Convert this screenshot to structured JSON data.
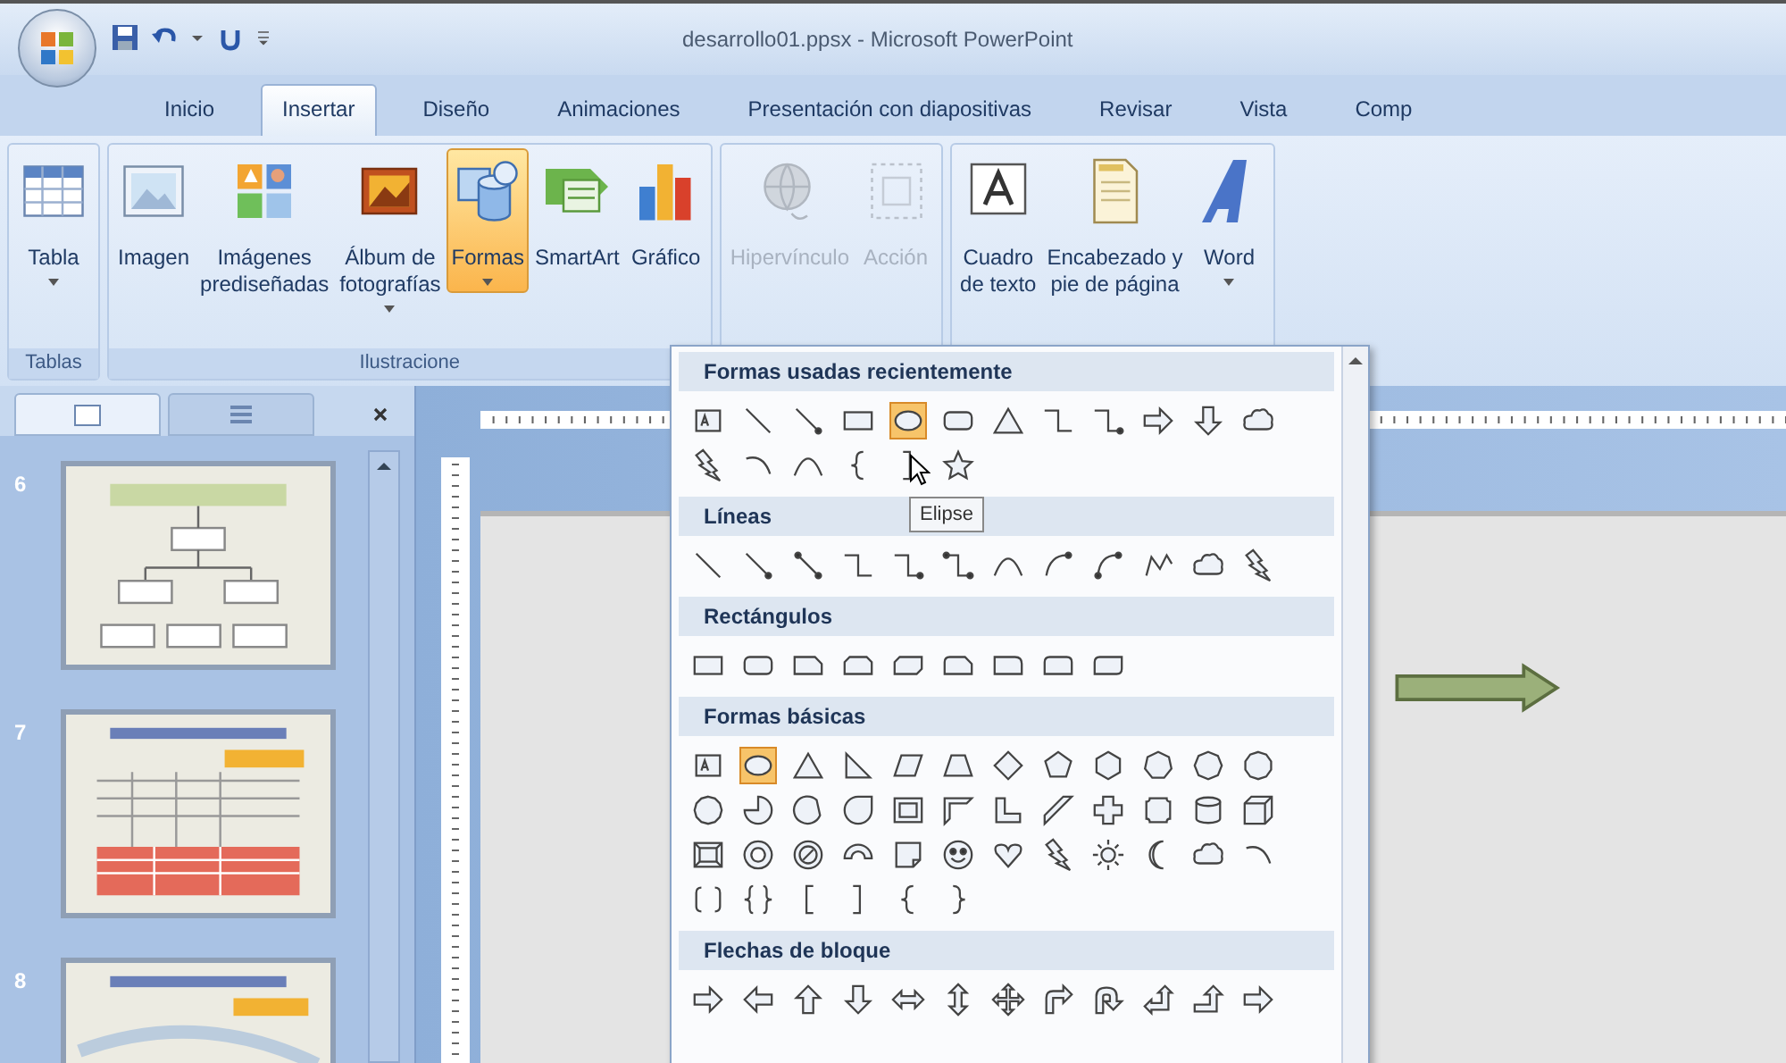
{
  "title_bar": {
    "title": "desarrollo01.ppsx - Microsoft PowerPoint"
  },
  "tabs": [
    {
      "label": "Inicio",
      "selected": false
    },
    {
      "label": "Insertar",
      "selected": true
    },
    {
      "label": "Diseño",
      "selected": false
    },
    {
      "label": "Animaciones",
      "selected": false
    },
    {
      "label": "Presentación con diapositivas",
      "selected": false
    },
    {
      "label": "Revisar",
      "selected": false
    },
    {
      "label": "Vista",
      "selected": false
    },
    {
      "label": "Comp",
      "selected": false
    }
  ],
  "ribbon": {
    "groups": [
      {
        "label": "Tablas",
        "buttons": [
          {
            "label": "Tabla",
            "kind": "table",
            "menu": true,
            "selected": false,
            "disabled": false
          }
        ]
      },
      {
        "label": "Ilustracione",
        "buttons": [
          {
            "label": "Imagen",
            "kind": "picture",
            "menu": false,
            "selected": false,
            "disabled": false
          },
          {
            "label": "Imágenes\nprediseñadas",
            "kind": "clipart",
            "menu": false,
            "selected": false,
            "disabled": false
          },
          {
            "label": "Álbum de\nfotografías",
            "kind": "album",
            "menu": true,
            "selected": false,
            "disabled": false
          },
          {
            "label": "Formas",
            "kind": "shapes",
            "menu": true,
            "selected": true,
            "disabled": false
          },
          {
            "label": "SmartArt",
            "kind": "smartart",
            "menu": false,
            "selected": false,
            "disabled": false
          },
          {
            "label": "Gráfico",
            "kind": "chart",
            "menu": false,
            "selected": false,
            "disabled": false
          }
        ]
      },
      {
        "buttons": [
          {
            "label": "Hipervínculo",
            "kind": "hyperlink",
            "menu": false,
            "selected": false,
            "disabled": true
          },
          {
            "label": "Acción",
            "kind": "action",
            "menu": false,
            "selected": false,
            "disabled": true
          }
        ]
      },
      {
        "buttons": [
          {
            "label": "Cuadro\nde texto",
            "kind": "textbox",
            "menu": false,
            "selected": false,
            "disabled": false
          },
          {
            "label": "Encabezado y\npie de página",
            "kind": "header",
            "menu": false,
            "selected": false,
            "disabled": false
          },
          {
            "label": "Word",
            "kind": "wordart",
            "menu": true,
            "selected": false,
            "disabled": false
          }
        ]
      }
    ]
  },
  "slides_pane": {
    "tabs": [
      {
        "kind": "slides",
        "selected": true
      },
      {
        "kind": "outline",
        "selected": false
      }
    ],
    "slides": [
      {
        "number": "6",
        "kind": "orgchart"
      },
      {
        "number": "7",
        "kind": "table"
      },
      {
        "number": "8",
        "kind": "diagram"
      }
    ]
  },
  "shapes_gallery": {
    "tooltip": "Elipse",
    "sections": [
      {
        "title": "Formas usadas recientemente",
        "rows": [
          [
            {
              "kind": "text-box",
              "selected": false
            },
            {
              "kind": "line",
              "selected": false
            },
            {
              "kind": "arrow-line",
              "selected": false
            },
            {
              "kind": "rectangle",
              "selected": false
            },
            {
              "kind": "ellipse",
              "selected": true
            },
            {
              "kind": "rounded-rectangle",
              "selected": false
            },
            {
              "kind": "triangle",
              "selected": false
            },
            {
              "kind": "elbow-connector",
              "selected": false
            },
            {
              "kind": "elbow-arrow",
              "selected": false
            },
            {
              "kind": "right-arrow",
              "selected": false
            },
            {
              "kind": "down-arrow",
              "selected": false
            },
            {
              "kind": "cloud",
              "selected": false
            }
          ],
          [
            {
              "kind": "lightning",
              "selected": false
            },
            {
              "kind": "arc",
              "selected": false
            },
            {
              "kind": "curve",
              "selected": false
            },
            {
              "kind": "left-brace",
              "selected": false
            },
            {
              "kind": "right-bracket",
              "selected": false
            },
            {
              "kind": "star",
              "selected": false
            }
          ]
        ]
      },
      {
        "title": "Líneas",
        "rows": [
          [
            {
              "kind": "line",
              "selected": false
            },
            {
              "kind": "arrow-line",
              "selected": false
            },
            {
              "kind": "double-arrow-line",
              "selected": false
            },
            {
              "kind": "elbow-connector",
              "selected": false
            },
            {
              "kind": "elbow-arrow",
              "selected": false
            },
            {
              "kind": "elbow-double-arrow",
              "selected": false
            },
            {
              "kind": "curve",
              "selected": false
            },
            {
              "kind": "curved-arrow",
              "selected": false
            },
            {
              "kind": "curved-double-arrow",
              "selected": false
            },
            {
              "kind": "freeform",
              "selected": false
            },
            {
              "kind": "cloud",
              "selected": false
            },
            {
              "kind": "lightning",
              "selected": false
            }
          ]
        ]
      },
      {
        "title": "Rectángulos",
        "rows": [
          [
            {
              "kind": "rectangle",
              "selected": false
            },
            {
              "kind": "rounded-rectangle",
              "selected": false
            },
            {
              "kind": "snip-rectangle",
              "selected": false
            },
            {
              "kind": "snip-two-corner",
              "selected": false
            },
            {
              "kind": "snip-diagonal",
              "selected": false
            },
            {
              "kind": "snip-round",
              "selected": false
            },
            {
              "kind": "round-one-corner",
              "selected": false
            },
            {
              "kind": "round-two-corner",
              "selected": false
            },
            {
              "kind": "round-diagonal",
              "selected": false
            }
          ]
        ]
      },
      {
        "title": "Formas básicas",
        "rows": [
          [
            {
              "kind": "text-box",
              "selected": false
            },
            {
              "kind": "ellipse",
              "selected": true
            },
            {
              "kind": "triangle",
              "selected": false
            },
            {
              "kind": "right-triangle",
              "selected": false
            },
            {
              "kind": "parallelogram",
              "selected": false
            },
            {
              "kind": "trapezoid",
              "selected": false
            },
            {
              "kind": "diamond",
              "selected": false
            },
            {
              "kind": "pentagon",
              "selected": false
            },
            {
              "kind": "hexagon",
              "selected": false
            },
            {
              "kind": "heptagon",
              "selected": false
            },
            {
              "kind": "octagon",
              "selected": false
            },
            {
              "kind": "decagon",
              "selected": false
            }
          ],
          [
            {
              "kind": "dodecagon",
              "selected": false
            },
            {
              "kind": "pie",
              "selected": false
            },
            {
              "kind": "chord",
              "selected": false
            },
            {
              "kind": "teardrop",
              "selected": false
            },
            {
              "kind": "frame",
              "selected": false
            },
            {
              "kind": "half-frame",
              "selected": false
            },
            {
              "kind": "l-shape",
              "selected": false
            },
            {
              "kind": "diagonal-stripe",
              "selected": false
            },
            {
              "kind": "cross",
              "selected": false
            },
            {
              "kind": "plaque",
              "selected": false
            },
            {
              "kind": "cylinder",
              "selected": false
            },
            {
              "kind": "cube",
              "selected": false
            }
          ],
          [
            {
              "kind": "bevel",
              "selected": false
            },
            {
              "kind": "donut",
              "selected": false
            },
            {
              "kind": "no-symbol",
              "selected": false
            },
            {
              "kind": "block-arc",
              "selected": false
            },
            {
              "kind": "folded-corner",
              "selected": false
            },
            {
              "kind": "smiley",
              "selected": false
            },
            {
              "kind": "heart",
              "selected": false
            },
            {
              "kind": "lightning",
              "selected": false
            },
            {
              "kind": "sun",
              "selected": false
            },
            {
              "kind": "moon",
              "selected": false
            },
            {
              "kind": "cloud",
              "selected": false
            },
            {
              "kind": "arc",
              "selected": false
            }
          ],
          [
            {
              "kind": "bracket-pair",
              "selected": false
            },
            {
              "kind": "brace-pair",
              "selected": false
            },
            {
              "kind": "left-bracket",
              "selected": false
            },
            {
              "kind": "right-bracket",
              "selected": false
            },
            {
              "kind": "left-brace",
              "selected": false
            },
            {
              "kind": "right-brace",
              "selected": false
            }
          ]
        ]
      },
      {
        "title": "Flechas de bloque",
        "rows": [
          [
            {
              "kind": "right-arrow",
              "selected": false
            },
            {
              "kind": "left-arrow",
              "selected": false
            },
            {
              "kind": "up-arrow",
              "selected": false
            },
            {
              "kind": "down-arrow",
              "selected": false
            },
            {
              "kind": "left-right-arrow",
              "selected": false
            },
            {
              "kind": "up-down-arrow",
              "selected": false
            },
            {
              "kind": "quad-arrow",
              "selected": false
            },
            {
              "kind": "bent-arrow",
              "selected": false
            },
            {
              "kind": "u-turn-arrow",
              "selected": false
            },
            {
              "kind": "left-up-arrow",
              "selected": false
            },
            {
              "kind": "bent-up-arrow",
              "selected": false
            },
            {
              "kind": "right-arrow",
              "selected": false
            }
          ]
        ]
      }
    ]
  }
}
